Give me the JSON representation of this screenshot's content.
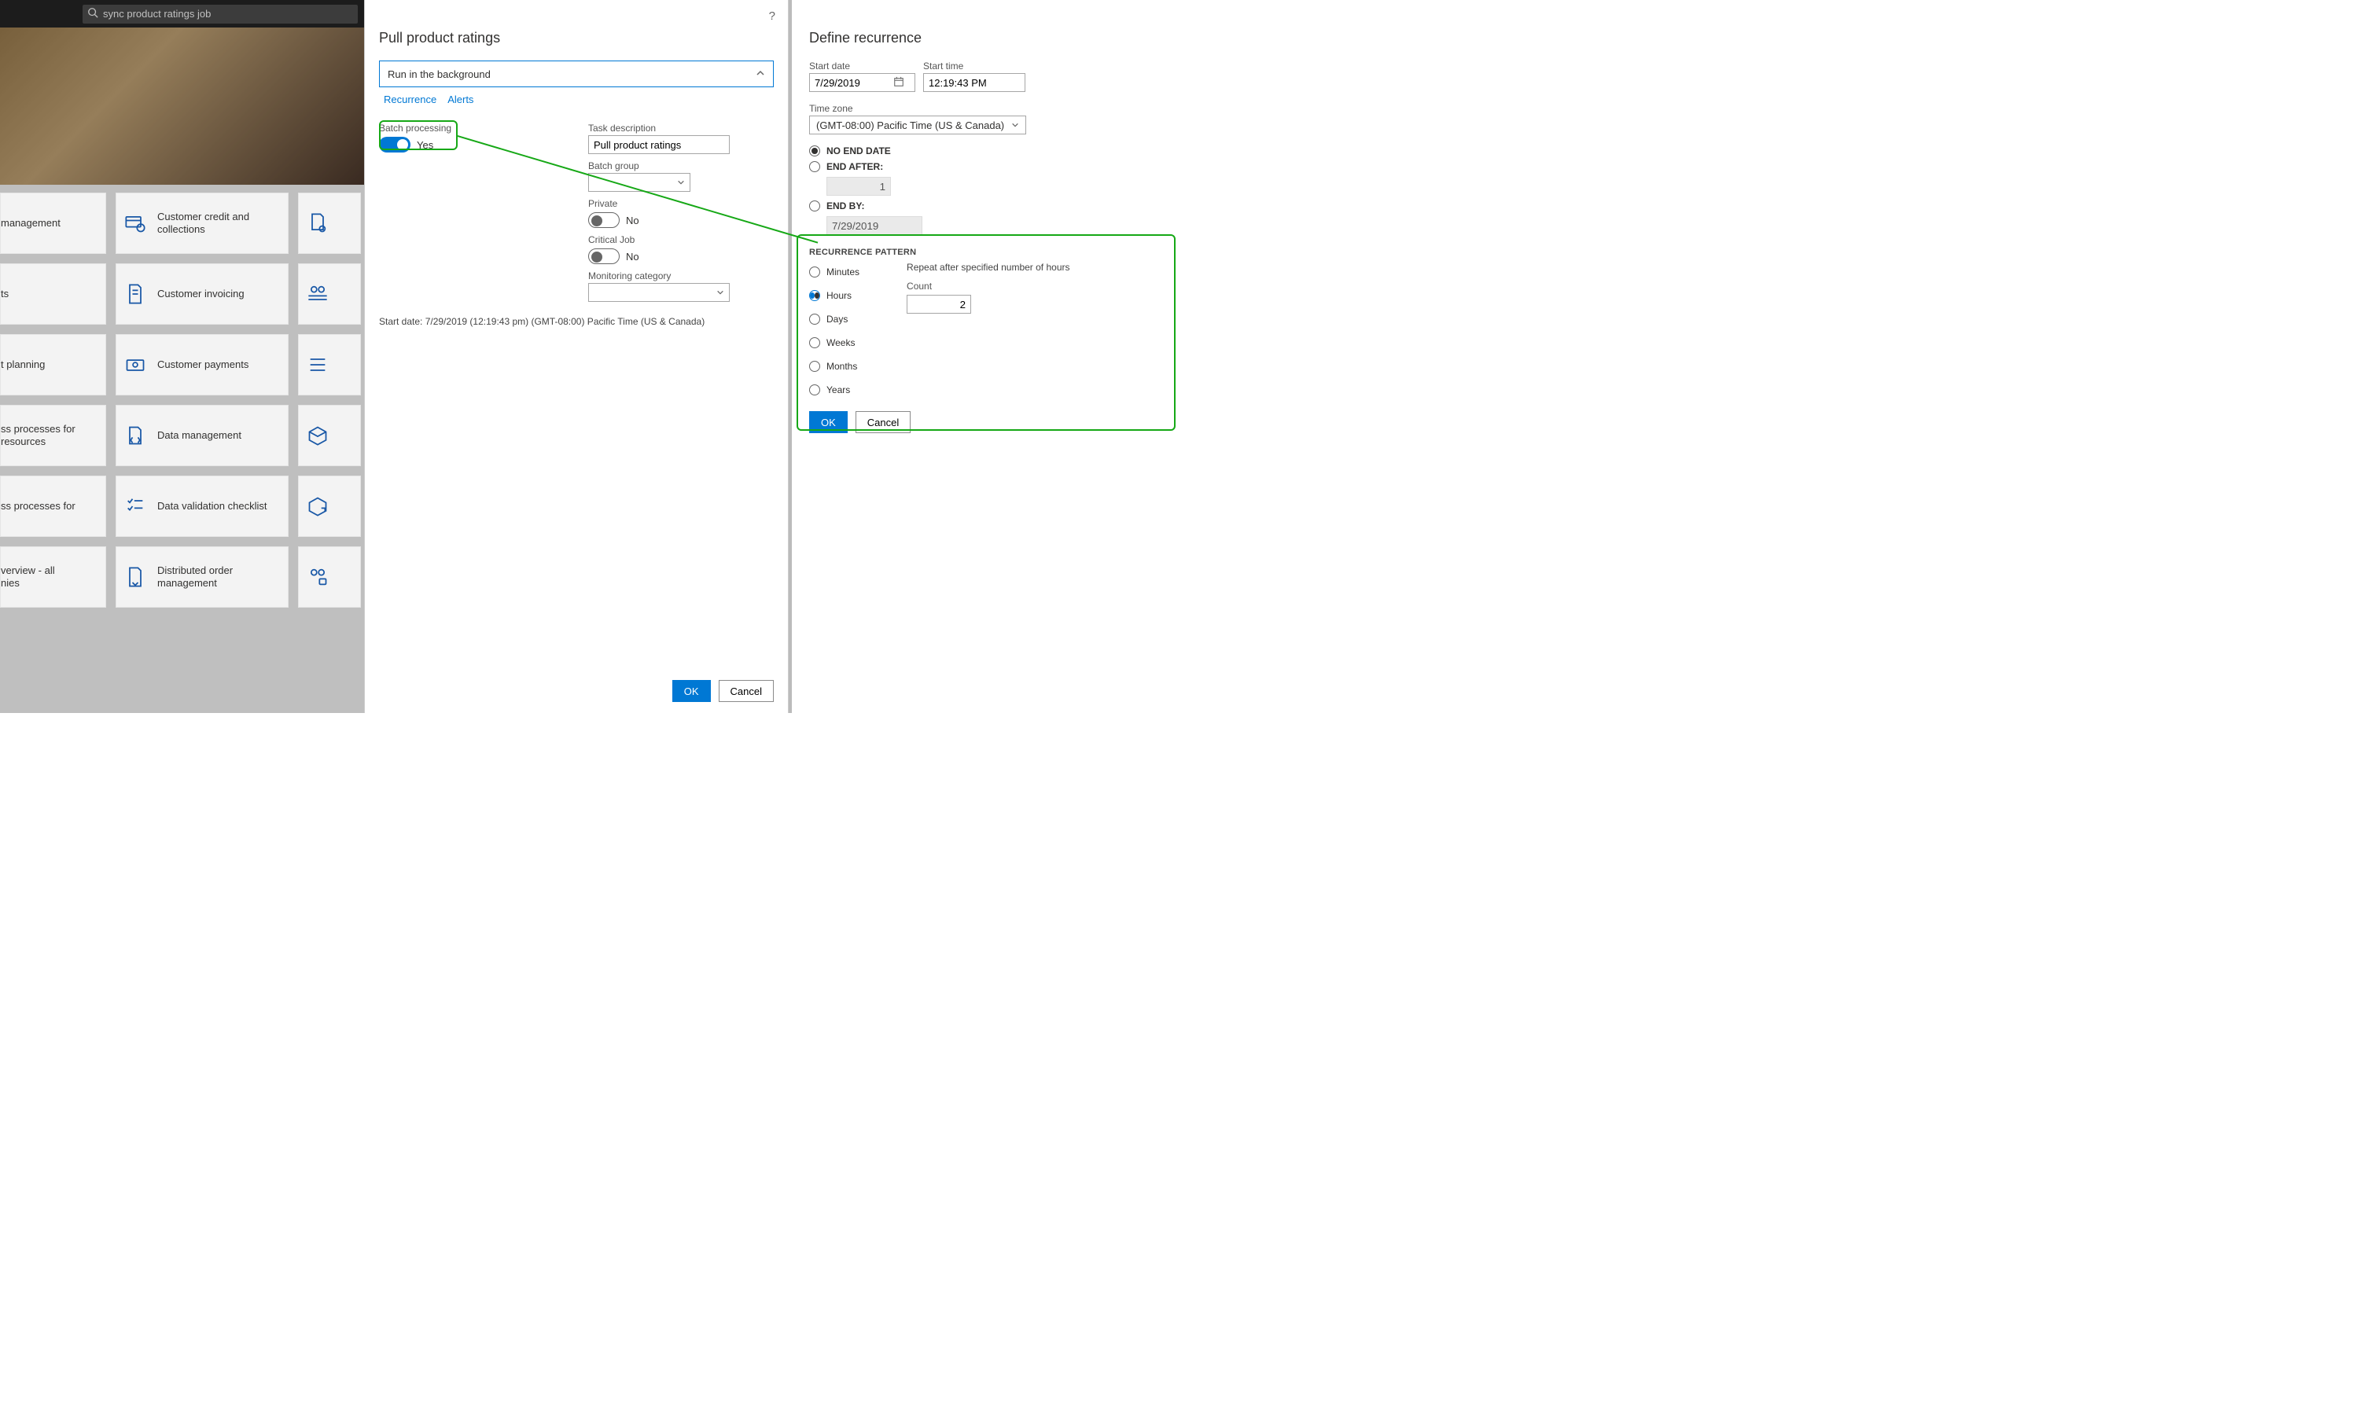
{
  "search": {
    "value": "sync product ratings job"
  },
  "tiles": {
    "col1": [
      "management",
      "ts",
      "t planning",
      "ss processes for\nresources",
      "ss processes for",
      "verview - all\nnies"
    ],
    "col2": [
      "Customer credit and collections",
      "Customer invoicing",
      "Customer payments",
      "Data management",
      "Data validation checklist",
      "Distributed order management"
    ]
  },
  "center": {
    "title": "Pull product ratings",
    "section": "Run in the background",
    "tabs": {
      "recurrence": "Recurrence",
      "alerts": "Alerts"
    },
    "batch_processing_label": "Batch processing",
    "batch_processing_value": "Yes",
    "task_description_label": "Task description",
    "task_description_value": "Pull product ratings",
    "batch_group_label": "Batch group",
    "private_label": "Private",
    "private_value": "No",
    "critical_label": "Critical Job",
    "critical_value": "No",
    "monitoring_label": "Monitoring category",
    "status": "Start date: 7/29/2019 (12:19:43 pm) (GMT-08:00) Pacific Time (US & Canada)",
    "ok": "OK",
    "cancel": "Cancel"
  },
  "right": {
    "title": "Define recurrence",
    "start_date_label": "Start date",
    "start_date_value": "7/29/2019",
    "start_time_label": "Start time",
    "start_time_value": "12:19:43 PM",
    "tz_label": "Time zone",
    "tz_value": "(GMT-08:00) Pacific Time (US & Canada)",
    "end_options": {
      "no_end": "NO END DATE",
      "end_after": "END AFTER:",
      "end_after_value": "1",
      "end_by": "END BY:",
      "end_by_value": "7/29/2019",
      "selected": "no_end"
    },
    "pattern_caption": "RECURRENCE PATTERN",
    "pattern_hint": "Repeat after specified number of hours",
    "count_label": "Count",
    "count_value": "2",
    "units": [
      "Minutes",
      "Hours",
      "Days",
      "Weeks",
      "Months",
      "Years"
    ],
    "units_selected": "Hours",
    "ok": "OK",
    "cancel": "Cancel"
  }
}
